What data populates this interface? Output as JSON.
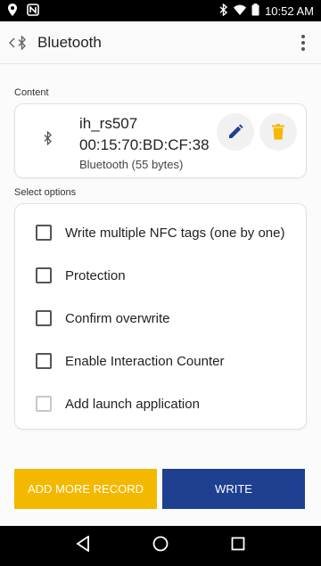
{
  "status_bar": {
    "time": "10:52 AM"
  },
  "app_bar": {
    "title": "Bluetooth"
  },
  "content_section": {
    "label": "Content",
    "record": {
      "name": "ih_rs507",
      "address": "00:15:70:BD:CF:38",
      "type": "Bluetooth (55 bytes)"
    }
  },
  "options_section": {
    "label": "Select options",
    "options": [
      {
        "label": "Write multiple NFC tags (one by one)",
        "checked": false,
        "enabled": true
      },
      {
        "label": "Protection",
        "checked": false,
        "enabled": true
      },
      {
        "label": "Confirm overwrite",
        "checked": false,
        "enabled": true
      },
      {
        "label": "Enable Interaction Counter",
        "checked": false,
        "enabled": true
      },
      {
        "label": "Add launch application",
        "checked": false,
        "enabled": false
      }
    ]
  },
  "actions": {
    "add_more_label": "ADD MORE RECORD",
    "write_label": "WRITE"
  },
  "colors": {
    "accent_yellow": "#f5b800",
    "accent_blue": "#1f3f91"
  }
}
